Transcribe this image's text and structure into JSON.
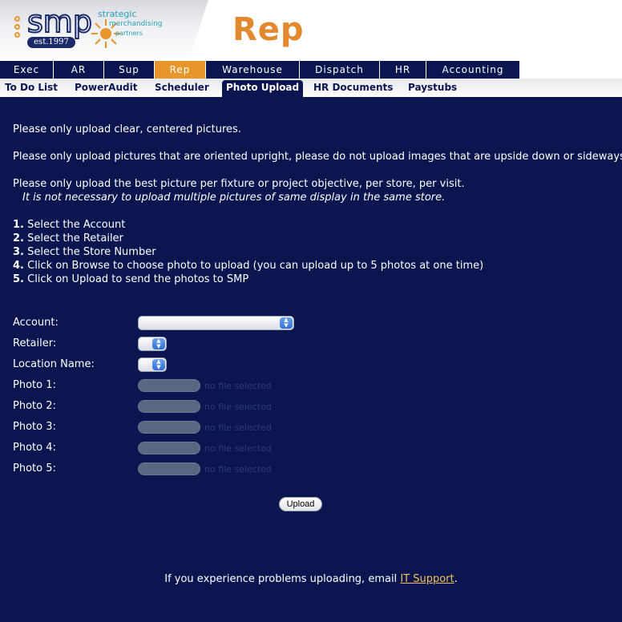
{
  "header": {
    "logo": {
      "brand": "smp",
      "est": "est.1997",
      "tagline_1": "strategic",
      "tagline_2": "merchandising",
      "tagline_3": "partners"
    },
    "section_title": "Rep",
    "accent_color": "#e8952c",
    "background_color": "#0b1550"
  },
  "main_nav": {
    "tabs": [
      {
        "label": "Exec",
        "active": false
      },
      {
        "label": "AR",
        "active": false
      },
      {
        "label": "Sup",
        "active": false
      },
      {
        "label": "Rep",
        "active": true
      },
      {
        "label": "Warehouse",
        "active": false
      },
      {
        "label": "Dispatch",
        "active": false
      },
      {
        "label": "HR",
        "active": false
      },
      {
        "label": "Accounting",
        "active": false
      }
    ]
  },
  "sub_nav": {
    "tabs": [
      {
        "label": "To Do List",
        "active": false
      },
      {
        "label": "PowerAudit",
        "active": false
      },
      {
        "label": "Scheduler",
        "active": false
      },
      {
        "label": "Photo Upload",
        "active": true
      },
      {
        "label": "HR Documents",
        "active": false
      },
      {
        "label": "Paystubs",
        "active": false
      }
    ]
  },
  "instructions": {
    "line1": "Please only upload clear, centered pictures.",
    "line2": "Please only upload pictures that are oriented upright, please do not upload images that are upside down or sideways.",
    "line3": "Please only upload the best picture per fixture or project objective, per store, per visit.",
    "line3_note": "It is not necessary to upload multiple pictures of same display in the same store.",
    "steps": [
      {
        "num": "1.",
        "text": " Select the Account"
      },
      {
        "num": "2.",
        "text": " Select the Retailer"
      },
      {
        "num": "3.",
        "text": " Select the Store Number"
      },
      {
        "num": "4.",
        "text": " Click on Browse to choose photo to upload (you can upload up to 5 photos at one time)"
      },
      {
        "num": "5.",
        "text": " Click on Upload to send the photos to SMP"
      }
    ]
  },
  "form": {
    "account_label": "Account:",
    "retailer_label": "Retailer:",
    "location_label": "Location Name:",
    "photos": [
      {
        "label": "Photo 1:",
        "status": "no file selected"
      },
      {
        "label": "Photo 2:",
        "status": "no file selected"
      },
      {
        "label": "Photo 3:",
        "status": "no file selected"
      },
      {
        "label": "Photo 4:",
        "status": "no file selected"
      },
      {
        "label": "Photo 5:",
        "status": "no file selected"
      }
    ],
    "upload_button": "Upload"
  },
  "footer": {
    "text_before": "If you experience problems uploading, email ",
    "link_text": "IT Support",
    "text_after": "."
  }
}
